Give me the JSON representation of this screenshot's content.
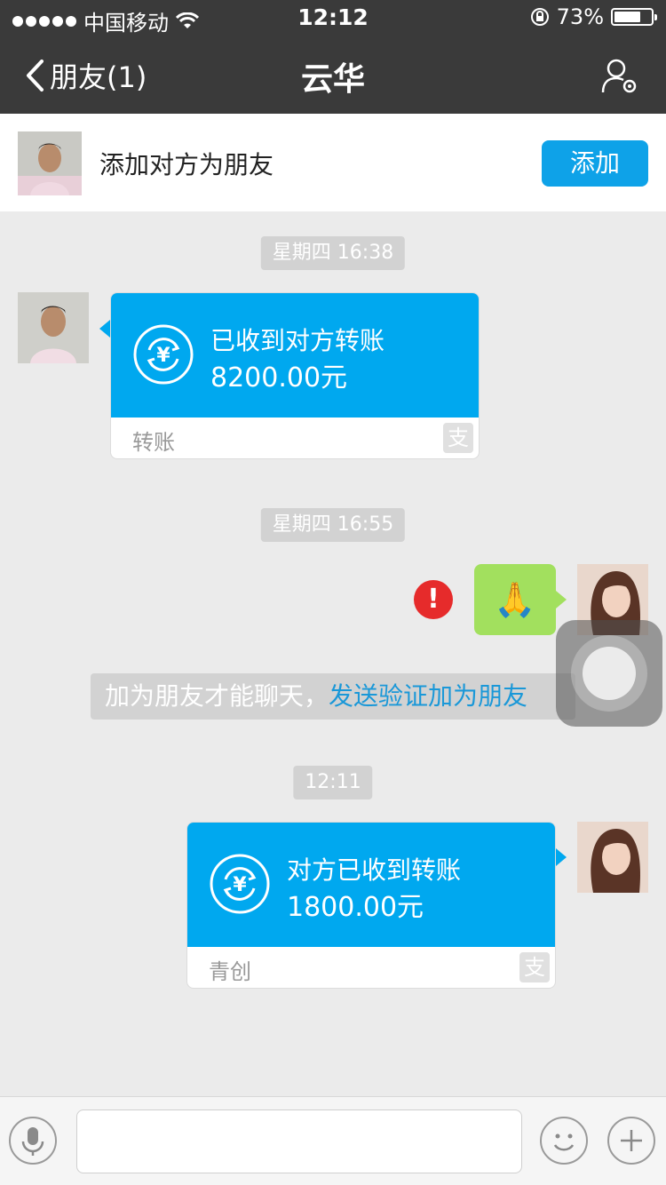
{
  "status_bar": {
    "carrier": "中国移动",
    "time": "12:12",
    "battery_percent": "73%",
    "battery_level": 0.73
  },
  "nav": {
    "back_label": "朋友(1)",
    "title": "云华"
  },
  "add_friend_bar": {
    "text": "添加对方为朋友",
    "button_label": "添加"
  },
  "messages": [
    {
      "type": "timestamp",
      "text": "星期四 16:38"
    },
    {
      "type": "transfer",
      "side": "left",
      "title": "已收到对方转账",
      "amount": "8200.00元",
      "footer": "转账"
    },
    {
      "type": "timestamp",
      "text": "星期四 16:55"
    },
    {
      "type": "emoji",
      "side": "right",
      "emoji": "🙏",
      "status": "!"
    },
    {
      "type": "system",
      "text_plain": "加为朋友才能聊天，",
      "link": "发送验证加为朋友"
    },
    {
      "type": "timestamp",
      "text": "12:11"
    },
    {
      "type": "transfer",
      "side": "right",
      "title": "对方已收到转账",
      "amount": "1800.00元",
      "footer": "青创"
    }
  ],
  "icons": {
    "alipay_mark": "支"
  },
  "colors": {
    "nav_bg": "#3a3a3a",
    "transfer_blue": "#00a8ef",
    "add_button": "#0ea2e8",
    "bubble_green": "#a2e05e",
    "error_red": "#e62b2b",
    "link_blue": "#1a98d8"
  }
}
